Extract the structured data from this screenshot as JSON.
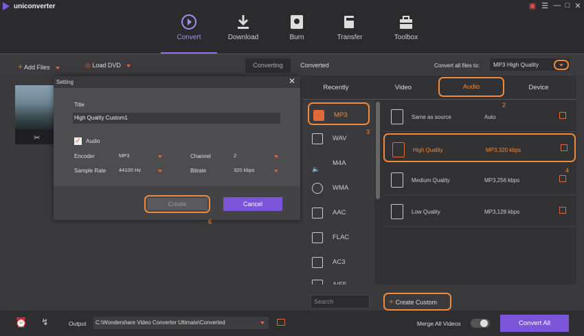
{
  "app": {
    "name": "uniconverter"
  },
  "nav": [
    {
      "label": "Convert"
    },
    {
      "label": "Download"
    },
    {
      "label": "Burn"
    },
    {
      "label": "Transfer"
    },
    {
      "label": "Toolbox"
    }
  ],
  "toolbar": {
    "add_files": "Add Files",
    "load_dvd": "Load DVD",
    "seg_converting": "Converting",
    "seg_converted": "Converted",
    "convert_all_label": "Convert all files to:",
    "convert_all_value": "MP3 High Quality"
  },
  "dialog": {
    "title": "Setting",
    "field_title": "Title",
    "title_value": "High Quality Custom1",
    "audio": "Audio",
    "encoder_label": "Encoder",
    "encoder": "MP3",
    "channel_label": "Channel",
    "channel": "2",
    "sample_rate_label": "Sample Rate",
    "sample_rate": "44100 Hz",
    "bitrate_label": "Bitrate",
    "bitrate": "320 kbps",
    "create": "Create",
    "cancel": "Cancel"
  },
  "format_panel": {
    "tabs": [
      "Recently",
      "Video",
      "Audio",
      "Device"
    ],
    "formats": [
      "MP3",
      "WAV",
      "M4A",
      "WMA",
      "AAC",
      "FLAC",
      "AC3",
      "AIFF"
    ],
    "qualities": [
      {
        "name": "Same as source",
        "value": "Auto",
        "icon": "SOURCE"
      },
      {
        "name": "High Quality",
        "value": "MP3,320 kbps",
        "icon": "HIGH"
      },
      {
        "name": "Medium Quality",
        "value": "MP3,256 kbps",
        "icon": "MEDIUM"
      },
      {
        "name": "Low Quality",
        "value": "MP3,128 kbps",
        "icon": "LOW"
      }
    ],
    "search_placeholder": "Search",
    "create_custom": "Create Custom"
  },
  "annotations": [
    "1",
    "2",
    "3",
    "4",
    "5",
    "6"
  ],
  "bottom": {
    "output_label": "Output",
    "output_path": "C:\\Wondershare Video Converter Ultimate\\Converted",
    "merge_label": "Merge All Videos",
    "convert_all": "Convert All"
  },
  "colors": {
    "accent_purple": "#8d6ff0",
    "highlight_orange": "#f08a3c",
    "icon_orange": "#e26a3a"
  }
}
